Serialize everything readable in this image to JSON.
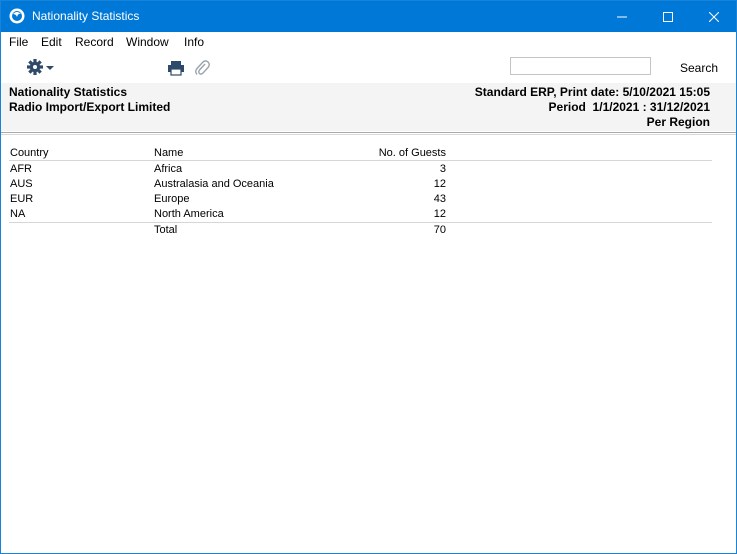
{
  "window": {
    "title": "Nationality Statistics",
    "accent_color": "#0078d7"
  },
  "menu": [
    "File",
    "Edit",
    "Record",
    "Window",
    "Info"
  ],
  "toolbar": {
    "search_placeholder": "",
    "search_label": "Search",
    "icons": [
      "gear-icon",
      "print-icon",
      "paperclip-icon"
    ]
  },
  "report": {
    "title": "Nationality Statistics",
    "company": "Radio Import/Export Limited",
    "print_info": "Standard ERP, Print date: 5/10/2021 15:05",
    "period": "Period  1/1/2021 : 31/12/2021",
    "grouping": "Per Region"
  },
  "table": {
    "headers": [
      "Country",
      "Name",
      "No. of Guests"
    ],
    "rows": [
      {
        "country": "AFR",
        "name": "Africa",
        "guests": "3"
      },
      {
        "country": "AUS",
        "name": "Australasia and Oceania",
        "guests": "12"
      },
      {
        "country": "EUR",
        "name": "Europe",
        "guests": "43"
      },
      {
        "country": "NA",
        "name": "North America",
        "guests": "12"
      }
    ],
    "total_label": "Total",
    "total_value": "70"
  }
}
